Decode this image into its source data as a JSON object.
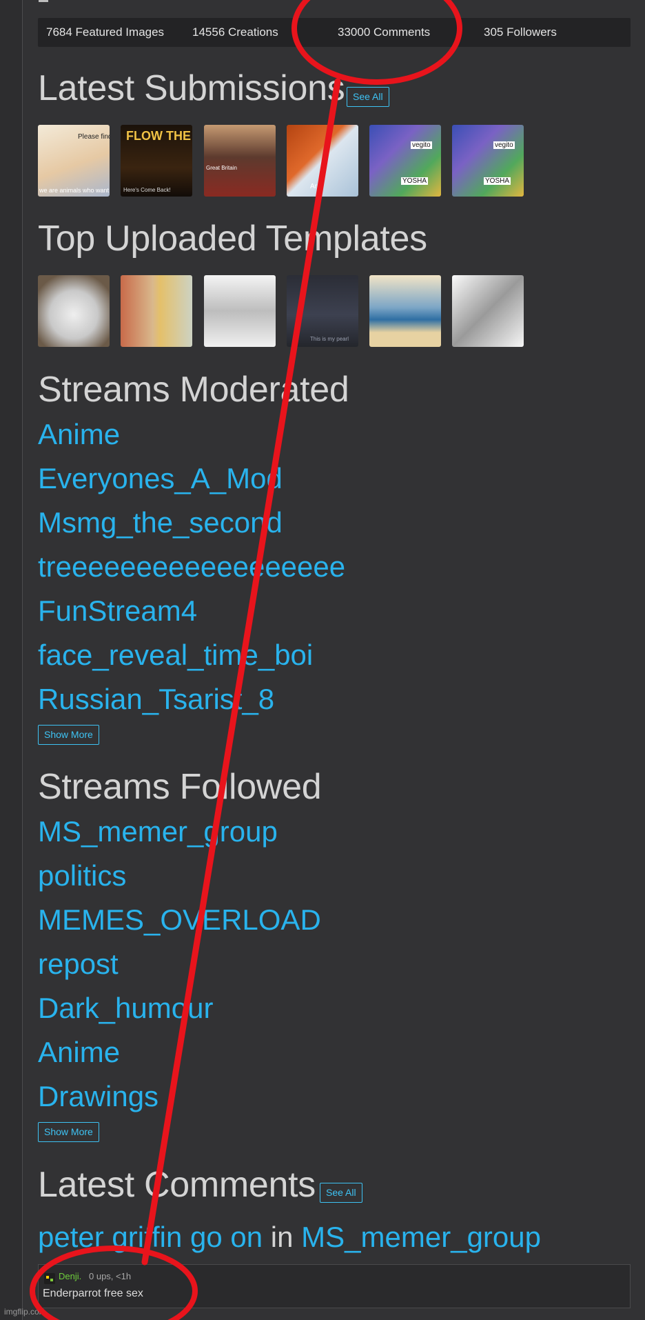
{
  "stats": {
    "featured": "7684 Featured Images",
    "creations": "14556 Creations",
    "comments": "33000 Comments",
    "followers": "305 Followers"
  },
  "latest_submissions": {
    "title": "Latest Submissions",
    "see_all": "See All",
    "thumbs": [
      {
        "caption_top": "Please find me",
        "caption_bottom": "we are animals who want it"
      },
      {
        "caption_top": "FLOW THE COVER",
        "caption_bottom": "Here's Come Back!"
      },
      {
        "caption_top": "",
        "caption_bottom": "Great Britain"
      },
      {
        "caption_top": "",
        "caption_bottom": "Arm"
      },
      {
        "caption_top": "vegito",
        "caption_bottom": "YOSHA"
      },
      {
        "caption_top": "vegito",
        "caption_bottom": "YOSHA"
      }
    ]
  },
  "top_templates": {
    "title": "Top Uploaded Templates",
    "thumbs": [
      {
        "caption": ""
      },
      {
        "caption": ""
      },
      {
        "caption": ""
      },
      {
        "caption": "This is my pearl"
      },
      {
        "caption": ""
      },
      {
        "caption": ""
      }
    ]
  },
  "streams_moderated": {
    "title": "Streams Moderated",
    "items": [
      "Anime",
      "Everyones_A_Mod",
      "Msmg_the_second",
      "treeeeeeeeeeeeeeeeee",
      "FunStream4",
      "face_reveal_time_boi",
      "Russian_Tsarist_8"
    ],
    "show_more": "Show More"
  },
  "streams_followed": {
    "title": "Streams Followed",
    "items": [
      "MS_memer_group",
      "politics",
      "MEMES_OVERLOAD",
      "repost",
      "Dark_humour",
      "Anime",
      "Drawings"
    ],
    "show_more": "Show More"
  },
  "latest_comments": {
    "title": "Latest Comments",
    "see_all": "See All",
    "post_title": "peter griffin go on",
    "in_word": "in",
    "stream": "MS_memer_group",
    "comment": {
      "user": "Denji.",
      "meta": "0 ups, <1h",
      "text": "Enderparrot free sex"
    }
  },
  "watermark": "imgflip.com",
  "colors": {
    "background": "#323234",
    "link": "#29b3ed",
    "annotation": "#e8141c"
  }
}
